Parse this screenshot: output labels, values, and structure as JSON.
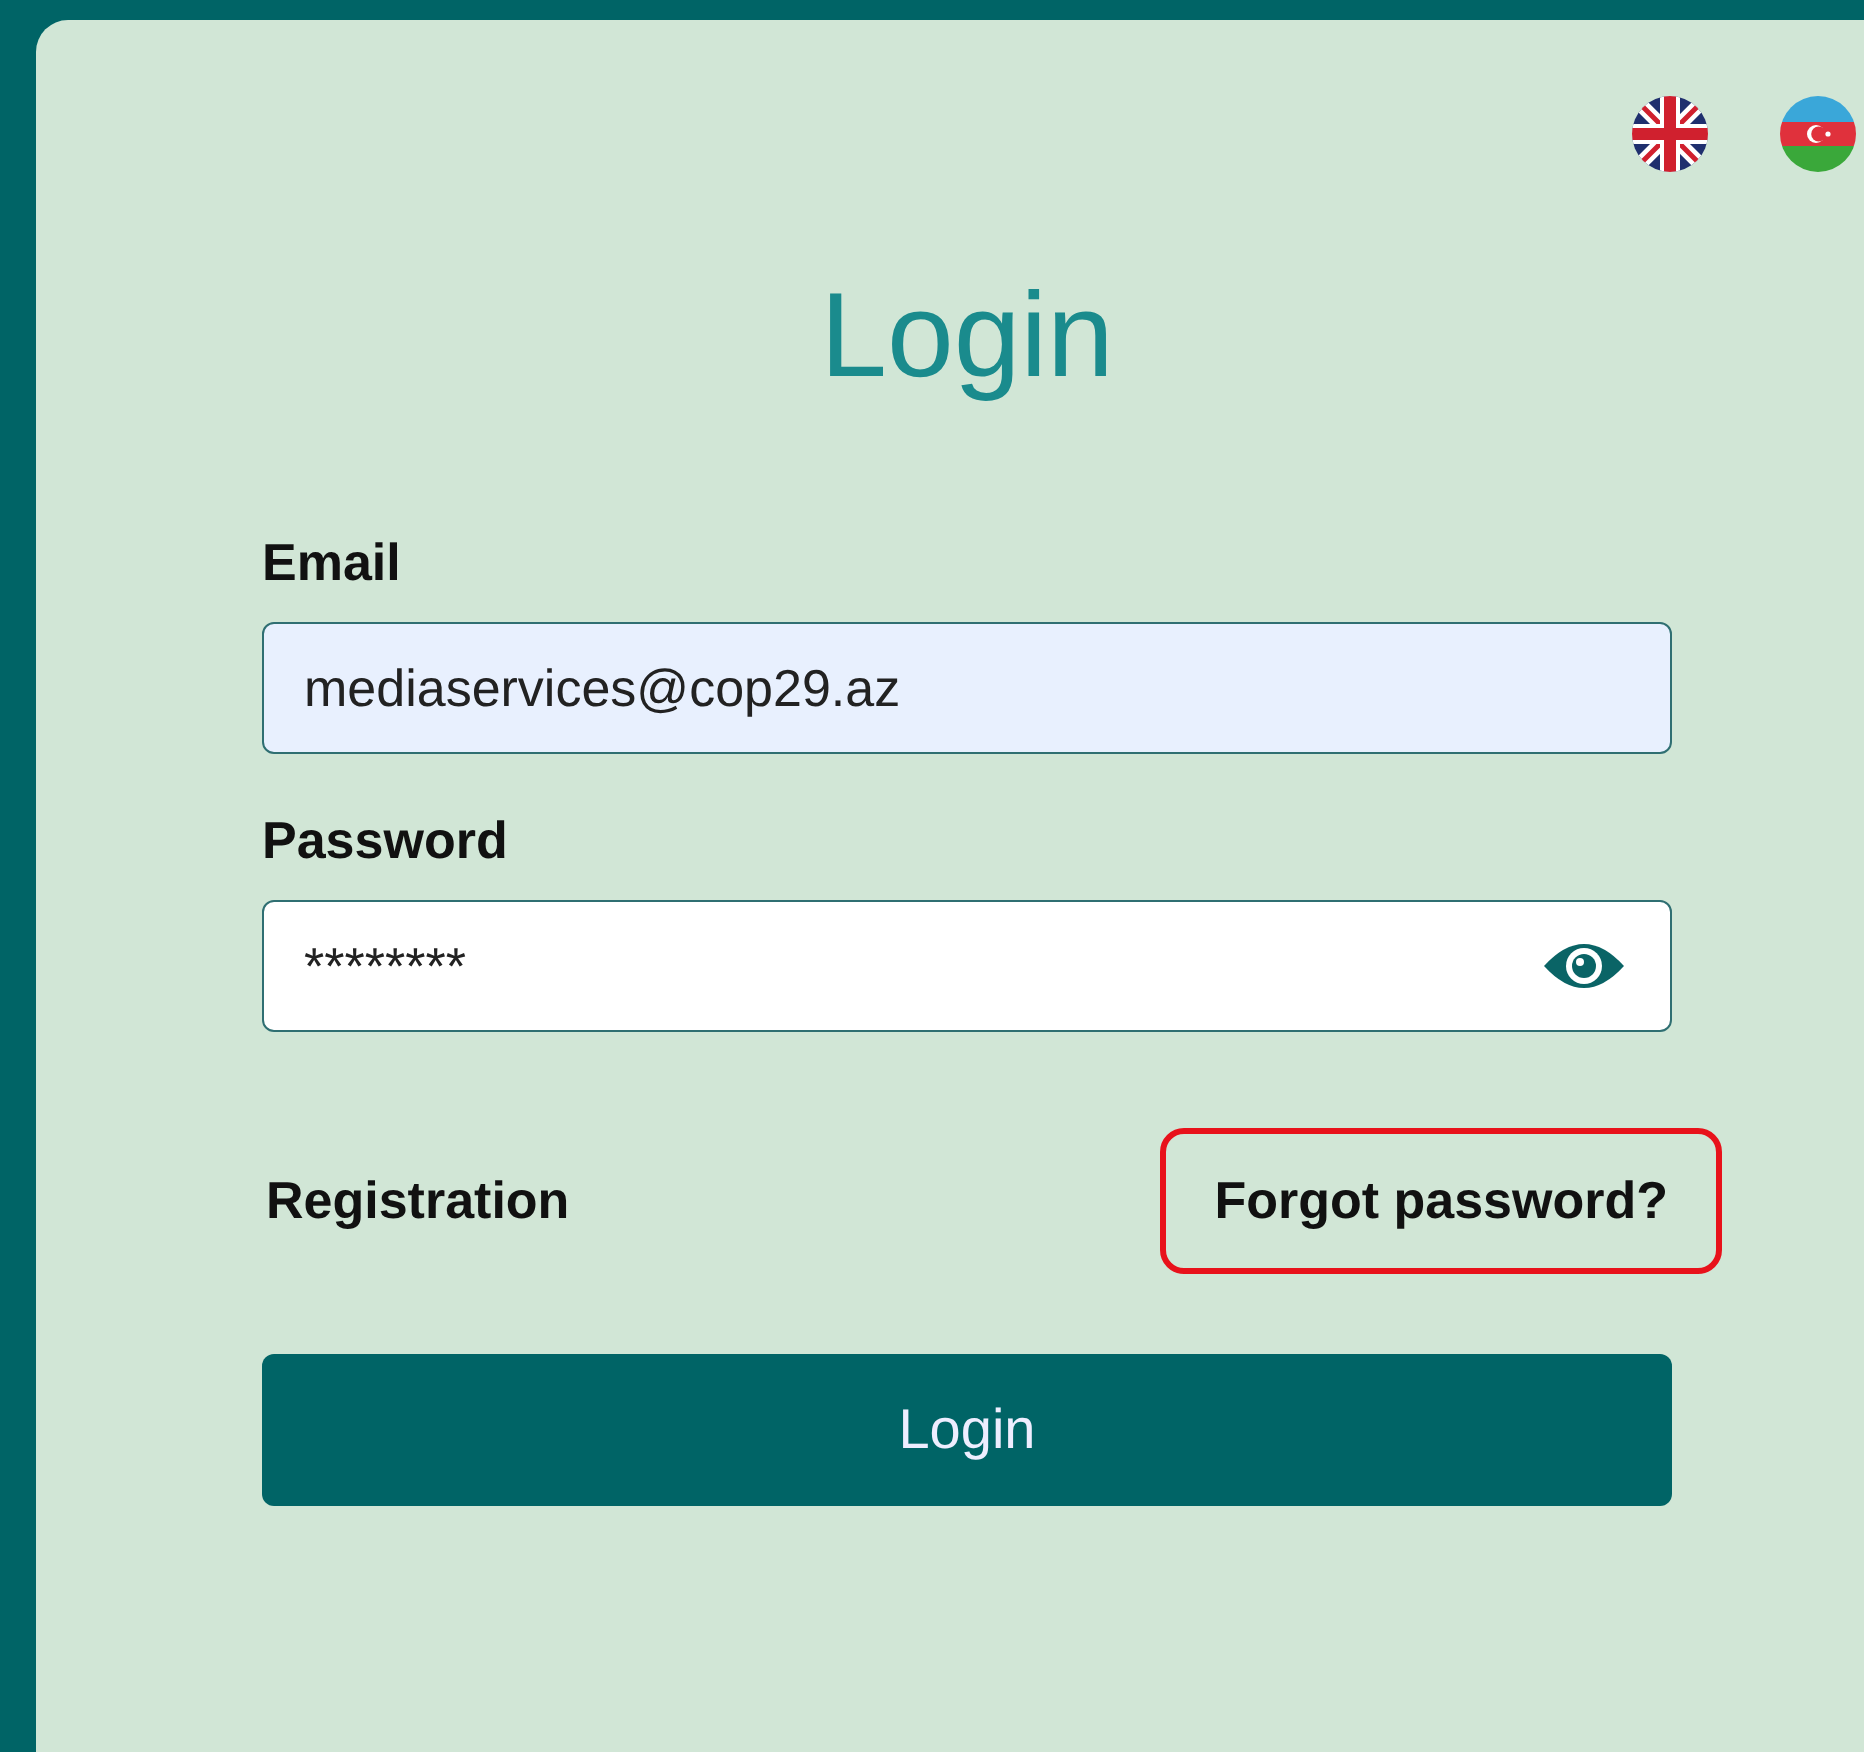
{
  "languages": [
    {
      "kind": "en"
    },
    {
      "kind": "az"
    }
  ],
  "title": "Login",
  "email": {
    "label": "Email",
    "value": "mediaservices@cop29.az",
    "autofilled": true
  },
  "password": {
    "label": "Password",
    "value": "********"
  },
  "links": [
    {
      "label": "Registration",
      "highlighted": false
    },
    {
      "label": "Forgot password?",
      "highlighted": true
    }
  ],
  "submit": "Login"
}
